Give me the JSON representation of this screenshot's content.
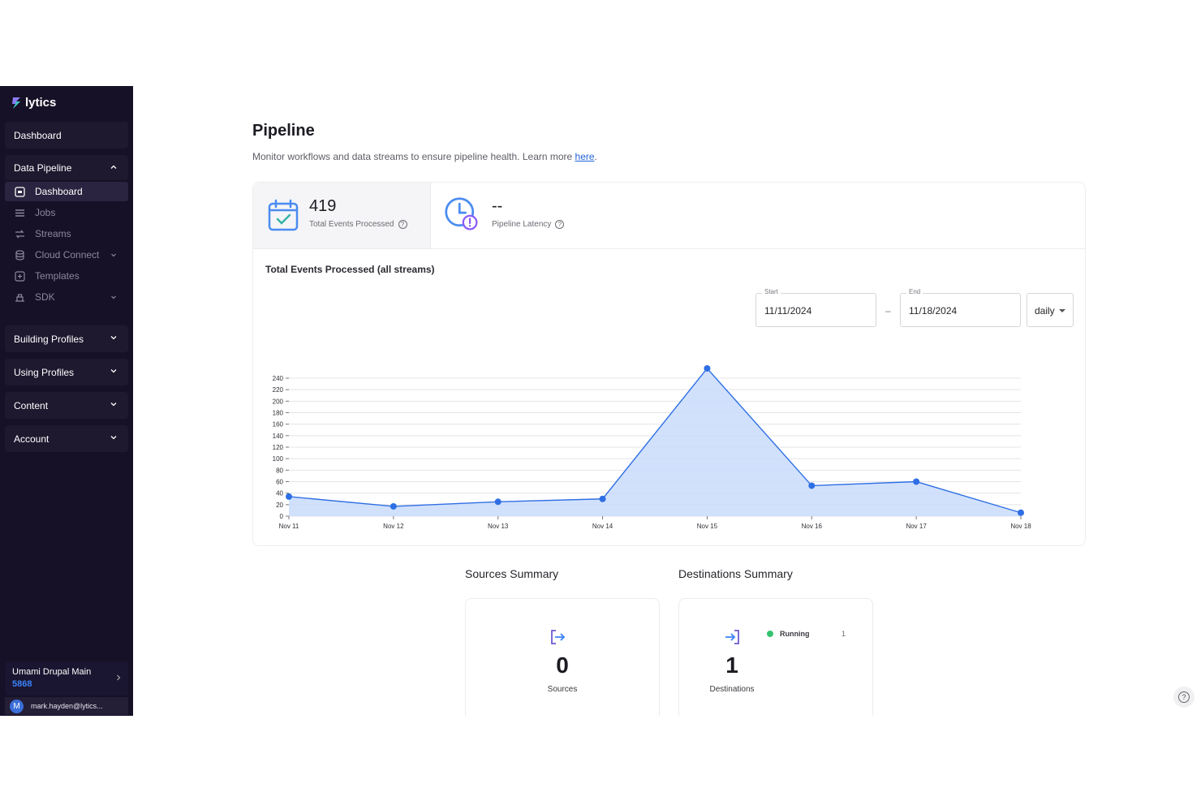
{
  "sidebar": {
    "brand": "lytics",
    "top_item": "Dashboard",
    "data_pipeline": {
      "label": "Data Pipeline",
      "items": [
        {
          "label": "Dashboard",
          "icon": "dashboard-icon",
          "active": true
        },
        {
          "label": "Jobs",
          "icon": "list-icon"
        },
        {
          "label": "Streams",
          "icon": "streams-icon"
        },
        {
          "label": "Cloud Connect",
          "icon": "database-icon",
          "expandable": true
        },
        {
          "label": "Templates",
          "icon": "template-icon"
        },
        {
          "label": "SDK",
          "icon": "sdk-icon",
          "expandable": true
        }
      ]
    },
    "sections": [
      "Building Profiles",
      "Using Profiles",
      "Content",
      "Account"
    ],
    "account": {
      "name": "Umami Drupal Main",
      "id": "5868"
    },
    "user": {
      "initial": "M",
      "email": "mark.hayden@lytics..."
    }
  },
  "page": {
    "title": "Pipeline",
    "description": "Monitor workflows and data streams to ensure pipeline health. Learn more ",
    "link_text": "here",
    "description_end": "."
  },
  "stats": {
    "events": {
      "value": "419",
      "label": "Total Events Processed"
    },
    "latency": {
      "value": "--",
      "label": "Pipeline Latency"
    }
  },
  "chart_section": {
    "title": "Total Events Processed (all streams)",
    "start_label": "Start",
    "start_value": "11/11/2024",
    "separator": "–",
    "end_label": "End",
    "end_value": "11/18/2024",
    "granularity": "daily"
  },
  "chart_data": {
    "type": "area",
    "title": "Total Events Processed (all streams)",
    "categories": [
      "Nov 11",
      "Nov 12",
      "Nov 13",
      "Nov 14",
      "Nov 15",
      "Nov 16",
      "Nov 17",
      "Nov 18"
    ],
    "series": [
      {
        "values": [
          34,
          17,
          25,
          30,
          257,
          53,
          60,
          6
        ]
      }
    ],
    "yticks": [
      0,
      20,
      40,
      60,
      80,
      100,
      120,
      140,
      160,
      180,
      200,
      220,
      240
    ],
    "ylim": [
      0,
      240
    ],
    "colors": {
      "line": "#2f6fe4",
      "fill": "#c9dcfb"
    },
    "grid": true
  },
  "summary": {
    "sources": {
      "title": "Sources Summary",
      "count": "0",
      "label": "Sources"
    },
    "destinations": {
      "title": "Destinations Summary",
      "count": "1",
      "label": "Destinations",
      "status": "Running",
      "status_count": "1"
    }
  }
}
